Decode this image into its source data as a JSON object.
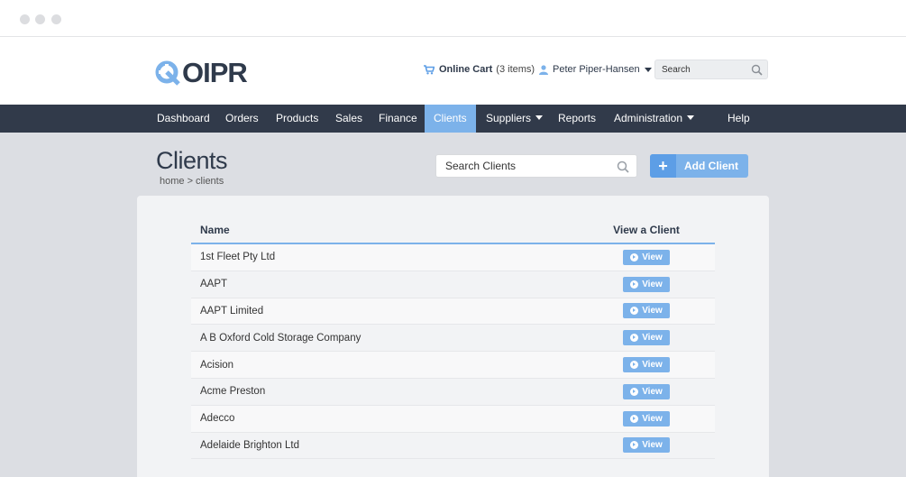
{
  "logo": {
    "text": "OIPR"
  },
  "header": {
    "cart_label": "Online Cart",
    "cart_count": "(3 items)",
    "user_name": "Peter Piper-Hansen",
    "search_placeholder": "Search"
  },
  "nav": {
    "items": [
      {
        "label": "Dashboard"
      },
      {
        "label": "Orders"
      },
      {
        "label": "Products"
      },
      {
        "label": "Sales"
      },
      {
        "label": "Finance"
      },
      {
        "label": "Clients"
      },
      {
        "label": "Suppliers"
      },
      {
        "label": "Reports"
      },
      {
        "label": "Administration"
      },
      {
        "label": "Help"
      }
    ],
    "active": "Clients"
  },
  "page": {
    "title": "Clients",
    "breadcrumb": "home > clients",
    "search_placeholder": "Search Clients",
    "add_button": "Add Client"
  },
  "table": {
    "headers": {
      "name": "Name",
      "view": "View a Client"
    },
    "view_label": "View",
    "rows": [
      {
        "name": "1st Fleet Pty Ltd"
      },
      {
        "name": "AAPT"
      },
      {
        "name": "AAPT Limited"
      },
      {
        "name": "A B Oxford Cold Storage Company"
      },
      {
        "name": "Acision"
      },
      {
        "name": "Acme Preston"
      },
      {
        "name": "Adecco"
      },
      {
        "name": "Adelaide Brighton Ltd"
      }
    ]
  },
  "colors": {
    "accent": "#7cb2ea",
    "nav_bg": "#313a4a",
    "text": "#2f3a4b"
  }
}
